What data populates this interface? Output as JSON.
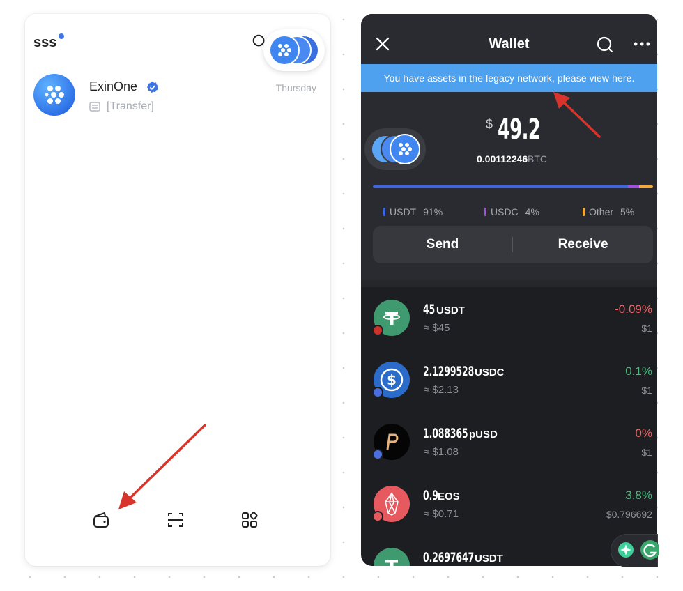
{
  "left": {
    "title": "sss",
    "chat": {
      "name": "ExinOne",
      "time": "Thursday",
      "message": "[Transfer]"
    },
    "bottom_nav": [
      "wallet-icon",
      "scan-icon",
      "apps-icon"
    ]
  },
  "right": {
    "header": {
      "title": "Wallet"
    },
    "banner": "You have assets in the legacy network, please view here.",
    "balance": {
      "currency_symbol": "$",
      "usd": "49.2",
      "btc": "0.00112246",
      "btc_label": "BTC"
    },
    "distribution": [
      {
        "label": "USDT",
        "pct": "91%",
        "fraction": 0.91,
        "color": "#3d66e0"
      },
      {
        "label": "USDC",
        "pct": "4%",
        "fraction": 0.04,
        "color": "#a24fe0"
      },
      {
        "label": "Other",
        "pct": "5%",
        "fraction": 0.05,
        "color": "#f2a93b"
      }
    ],
    "actions": {
      "send": "Send",
      "receive": "Receive"
    },
    "assets": [
      {
        "amount": "45",
        "symbol": "USDT",
        "value": "≈ $45",
        "change": "-0.09%",
        "price": "$1",
        "trend": "neg"
      },
      {
        "amount": "2.1299528",
        "symbol": "USDC",
        "value": "≈ $2.13",
        "change": "0.1%",
        "price": "$1",
        "trend": "pos"
      },
      {
        "amount": "1.088365",
        "symbol": "pUSD",
        "value": "≈ $1.08",
        "change": "0%",
        "price": "$1",
        "trend": "neg"
      },
      {
        "amount": "0.9",
        "symbol": "EOS",
        "value": "≈ $0.71",
        "change": "3.8%",
        "price": "$0.796692",
        "trend": "pos"
      },
      {
        "amount": "0.2697647",
        "symbol": "USDT",
        "value": "",
        "change": "",
        "price": "",
        "trend": "pos"
      }
    ]
  }
}
